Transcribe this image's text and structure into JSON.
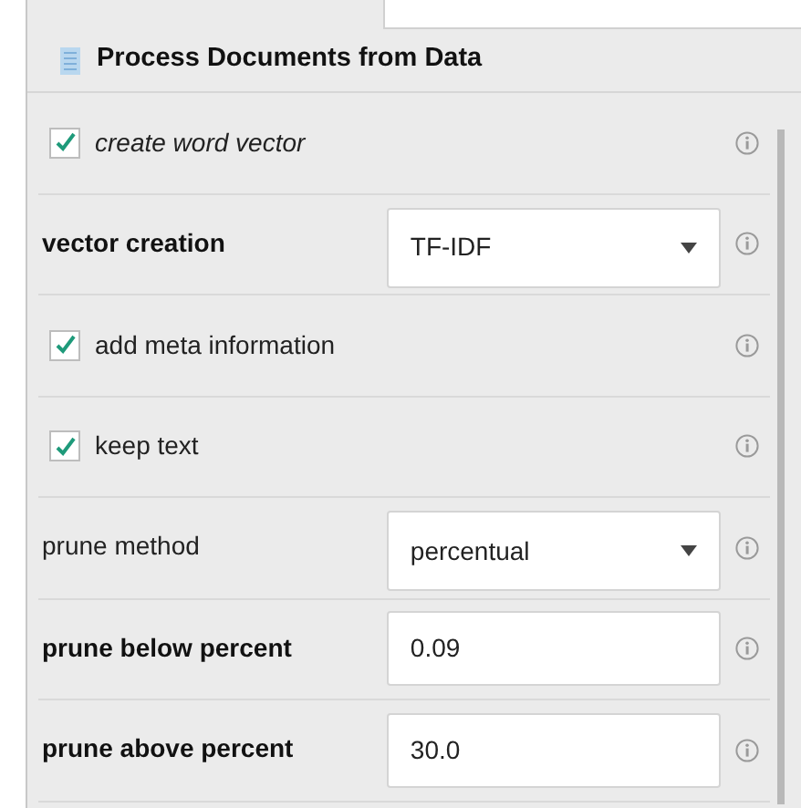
{
  "panel": {
    "title": "Process Documents from Data"
  },
  "parameters": [
    {
      "kind": "checkbox",
      "label": "create word vector",
      "required": false,
      "expert": true,
      "checked": true
    },
    {
      "kind": "select",
      "label": "vector creation",
      "required": true,
      "expert": false,
      "value": "TF-IDF"
    },
    {
      "kind": "checkbox",
      "label": "add meta information",
      "required": false,
      "expert": false,
      "checked": true
    },
    {
      "kind": "checkbox",
      "label": "keep text",
      "required": false,
      "expert": false,
      "checked": true
    },
    {
      "kind": "select",
      "label": "prune method",
      "required": false,
      "expert": false,
      "value": "percentual"
    },
    {
      "kind": "text",
      "label": "prune below percent",
      "required": true,
      "expert": false,
      "value": "0.09"
    },
    {
      "kind": "text",
      "label": "prune above percent",
      "required": true,
      "expert": false,
      "value": "30.0"
    }
  ]
}
